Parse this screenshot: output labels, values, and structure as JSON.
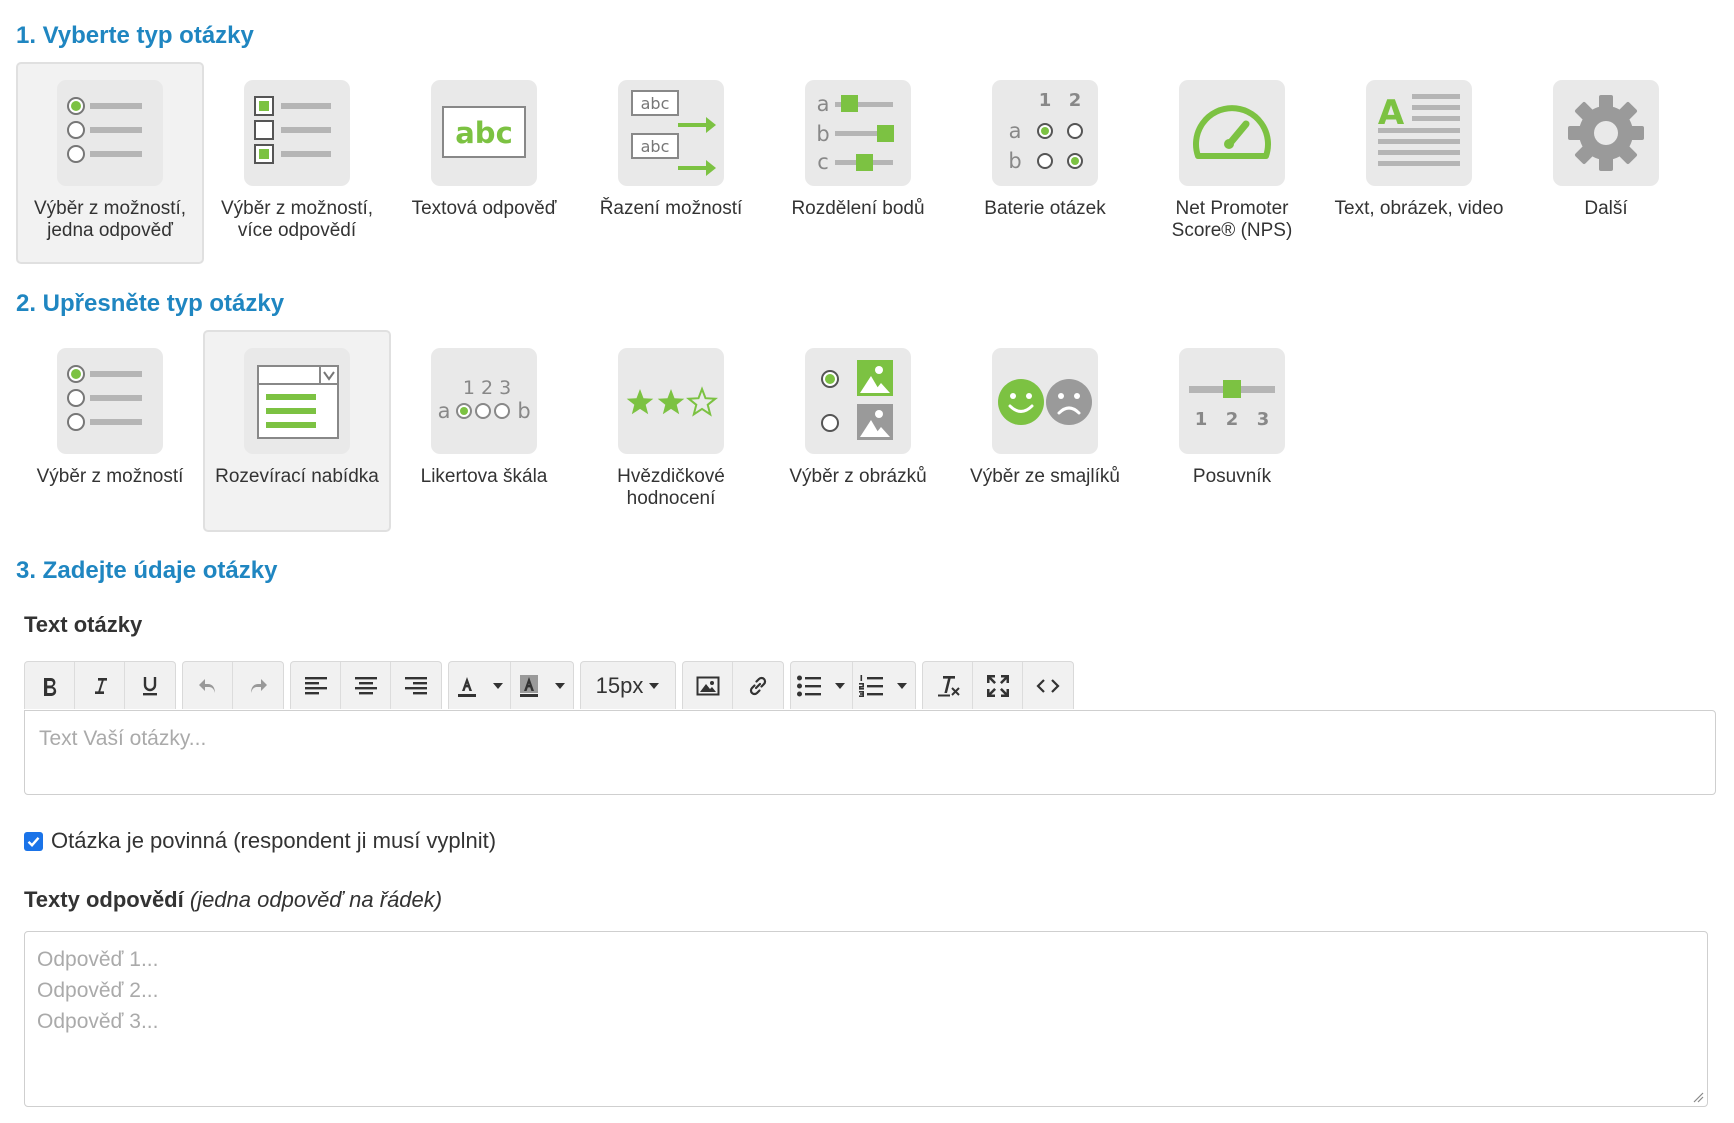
{
  "sections": {
    "select": {
      "title": "1. Vyberte typ otázky"
    },
    "specify": {
      "title": "2. Upřesněte typ otázky"
    },
    "details": {
      "title": "3. Zadejte údaje otázky"
    }
  },
  "question_types": [
    {
      "label": "Výběr z možností, jedna odpověď",
      "icon": "radio-list-icon",
      "selected": true
    },
    {
      "label": "Výběr z možností, více odpovědí",
      "icon": "checkbox-list-icon",
      "selected": false
    },
    {
      "label": "Textová odpověď",
      "icon": "text-abc-icon",
      "selected": false
    },
    {
      "label": "Řazení možností",
      "icon": "ranking-icon",
      "selected": false
    },
    {
      "label": "Rozdělení bodů",
      "icon": "points-sliders-icon",
      "selected": false
    },
    {
      "label": "Baterie otázek",
      "icon": "matrix-icon",
      "selected": false
    },
    {
      "label": "Net Promoter Score® (NPS)",
      "icon": "gauge-icon",
      "selected": false
    },
    {
      "label": "Text, obrázek, video",
      "icon": "text-image-icon",
      "selected": false
    },
    {
      "label": "Další",
      "icon": "gear-icon",
      "selected": false
    }
  ],
  "icon_text": {
    "abc": "abc",
    "a": "a",
    "b": "b",
    "c": "c",
    "n1": "1",
    "n2": "2",
    "n3": "3",
    "likert_nums": "1 2 3",
    "letter_a": "A"
  },
  "subtypes": [
    {
      "label": "Výběr z možností",
      "icon": "radio-list-icon",
      "selected": false
    },
    {
      "label": "Rozevírací nabídka",
      "icon": "dropdown-icon",
      "selected": true
    },
    {
      "label": "Likertova škála",
      "icon": "likert-icon",
      "selected": false
    },
    {
      "label": "Hvězdičkové hodnocení",
      "icon": "star-rating-icon",
      "selected": false
    },
    {
      "label": "Výběr z obrázků",
      "icon": "image-choice-icon",
      "selected": false
    },
    {
      "label": "Výběr ze smajlíků",
      "icon": "smiley-icon",
      "selected": false
    },
    {
      "label": "Posuvník",
      "icon": "slider-icon",
      "selected": false
    }
  ],
  "question_text": {
    "label": "Text otázky",
    "placeholder": "Text Vaší otázky...",
    "toolbar": {
      "font_size": "15px"
    }
  },
  "required": {
    "label": "Otázka je povinná (respondent ji musí vyplnit)",
    "checked": true
  },
  "answers": {
    "label": "Texty odpovědí",
    "hint": "(jedna odpověď na řádek)",
    "placeholder_lines": [
      "Odpověď 1...",
      "Odpověď 2...",
      "Odpověď 3..."
    ]
  },
  "colors": {
    "accent": "#1f86c1",
    "icon_green": "#7cc242",
    "icon_gray": "#b5b5b5"
  }
}
